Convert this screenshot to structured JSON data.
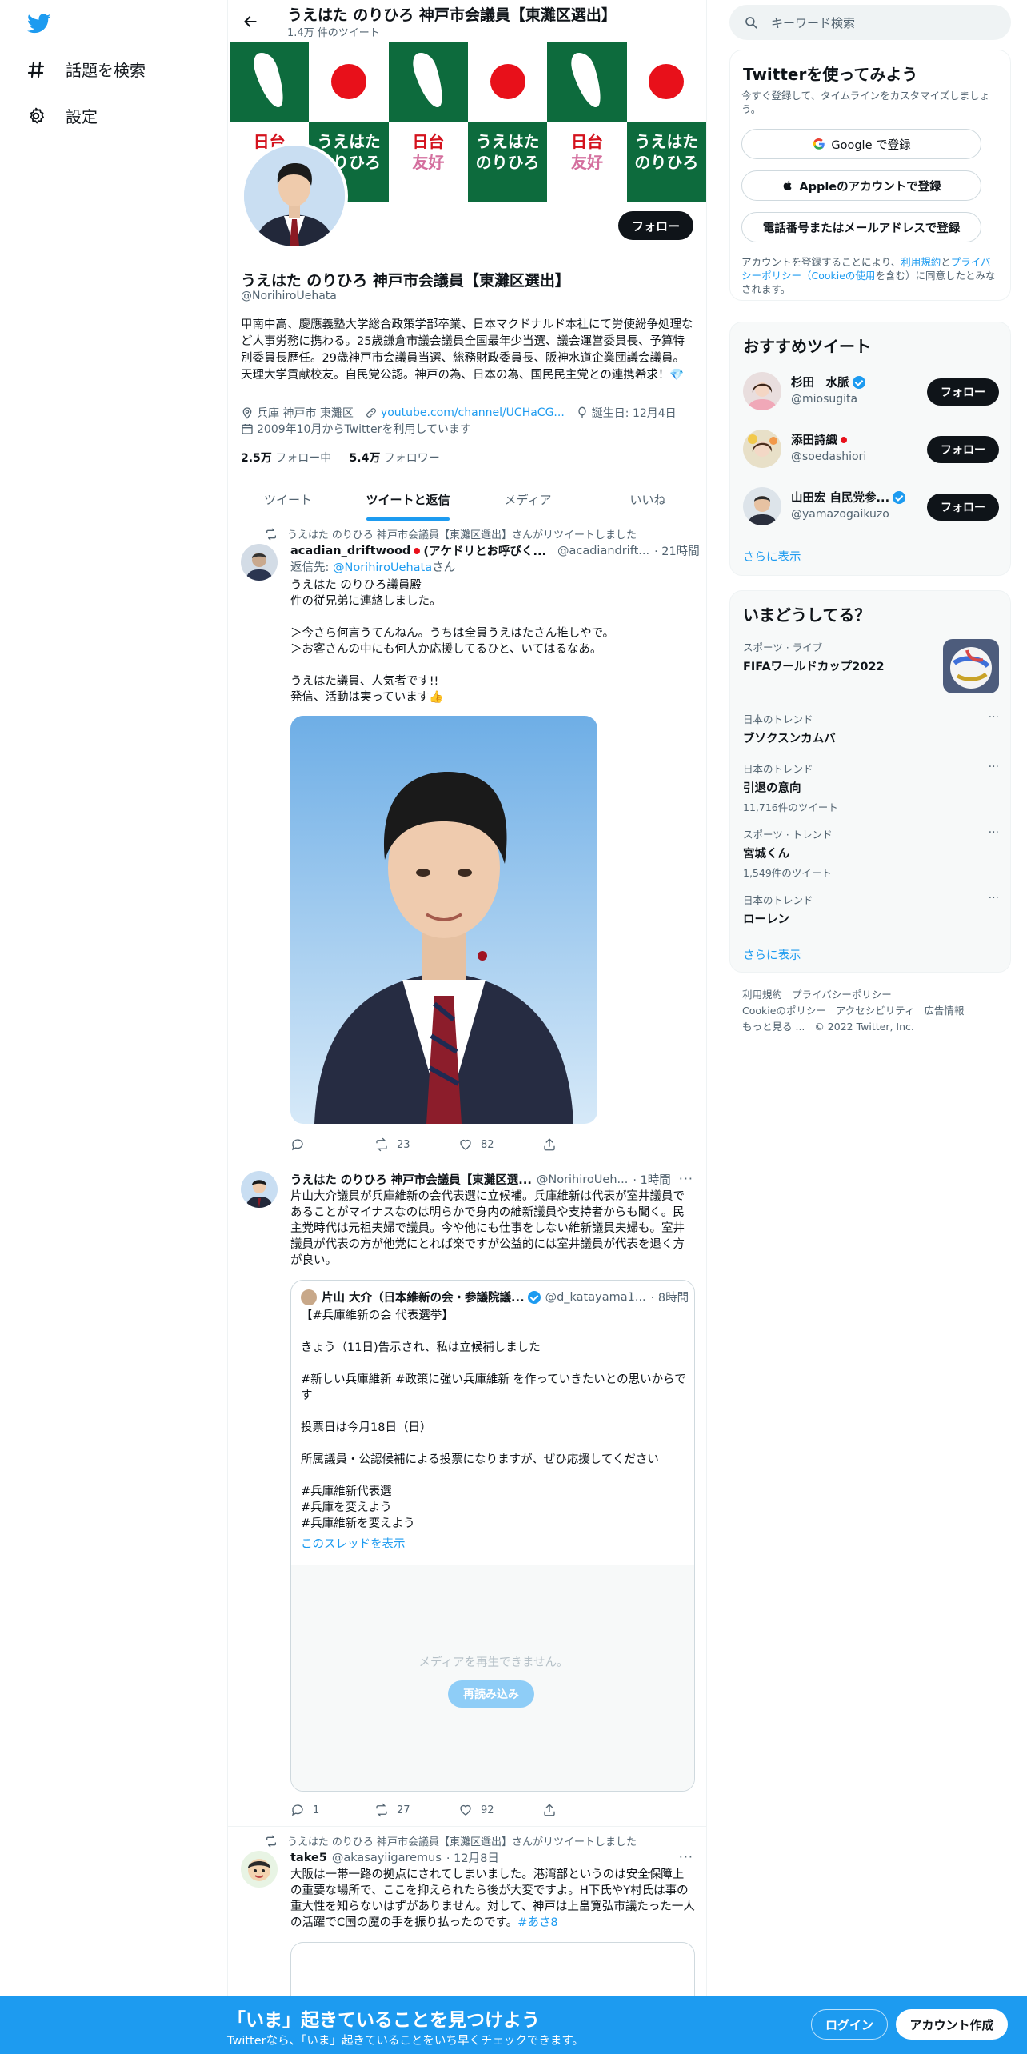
{
  "nav": {
    "explore_label": "話題を検索",
    "settings_label": "設定"
  },
  "profile": {
    "top_name": "うえはた のりひろ 神戸市会議員【東灘区選出】",
    "tweet_count": "1.4万 件のツイート",
    "banner_texts": [
      "日台",
      "うえはた",
      "のりひろ",
      "友好"
    ],
    "follow_label": "フォロー",
    "name": "うえはた のりひろ 神戸市会議員【東灘区選出】",
    "handle": "@NorihiroUehata",
    "bio": "甲南中高、慶應義塾大学総合政策学部卒業、日本マクドナルド本社にて労使紛争処理など人事労務に携わる。25歳鎌倉市議会議員全国最年少当選、議会運営委員長、予算特別委員長歴任。29歳神戸市会議員当選、総務財政委員長、阪神水道企業団議会議員。天理大学貢献校友。自民党公認。神戸の為、日本の為、国民民主党との連携希求！💎",
    "location": "兵庫 神戸市 東灘区",
    "website": "youtube.com/channel/UCHaCG...",
    "birthday": "誕生日: 12月4日",
    "joined": "2009年10月からTwitterを利用しています",
    "following_count": "2.5万",
    "following_label": "フォロー中",
    "followers_count": "5.4万",
    "followers_label": "フォロワー"
  },
  "tabs": [
    "ツイート",
    "ツイートと返信",
    "メディア",
    "いいね"
  ],
  "tweets": [
    {
      "retweet_note": "うえはた のりひろ 神戸市会議員【東灘区選出】さんがリツイートしました",
      "name": "acadian_driftwood",
      "name_suffix": "(アケドリとお呼びく...",
      "handle": "@acadiandrift...",
      "time": "· 21時間",
      "reply_to_label": "返信先: ",
      "reply_to_handle": "@NorihiroUehata",
      "reply_to_suffix": "さん",
      "body": "うえはた のりひろ議員殿\n件の従兄弟に連絡しました。\n\n＞今さら何言うてんねん。うちは全員うえはたさん推しやで。\n＞お客さんの中にも何人か応援してるひと、いてはるなあ。\n\nうえはた議員、人気者です!!\n発信、活動は実っています👍",
      "replies": "",
      "retweets": "23",
      "likes": "82"
    },
    {
      "name": "うえはた のりひろ 神戸市会議員【東灘区選...",
      "handle": "@NorihiroUeh...",
      "time": "· 1時間",
      "body": "片山大介議員が兵庫維新の会代表選に立候補。兵庫維新は代表が室井議員であることがマイナスなのは明らかで身内の維新議員や支持者からも聞く。民主党時代は元祖夫婦で議員。今や他にも仕事をしない維新議員夫婦も。室井議員が代表の方が他党にとれば楽ですが公益的には室井議員が代表を退く方が良い。",
      "quote": {
        "name": "片山 大介（日本維新の会・参議院議...",
        "handle": "@d_katayama1...",
        "time": "· 8時間",
        "body": "【#兵庫維新の会 代表選挙】\n\nきょう（11日)告示され、私は立候補しました\n\n#新しい兵庫維新 #政策に強い兵庫維新 を作っていきたいとの思いからです\n\n投票日は今月18日（日）\n\n所属議員・公認候補による投票になりますが、ぜひ応援してください\n\n#兵庫維新代表選\n#兵庫を変えよう\n#兵庫維新を変えよう",
        "thread_link": "このスレッドを表示",
        "media_error": "メディアを再生できません。",
        "reload_label": "再読み込み"
      },
      "replies": "1",
      "retweets": "27",
      "likes": "92"
    },
    {
      "retweet_note": "うえはた のりひろ 神戸市会議員【東灘区選出】さんがリツイートしました",
      "name": "take5",
      "handle": "@akasayiigaremus",
      "time": "· 12月8日",
      "body": "大阪は一帯一路の拠点にされてしまいました。港湾部というのは安全保障上の重要な場所で、ここを抑えられたら後が大変ですよ。H下氏やY村氏は事の重大性を知らないはずがありません。対して、神戸は上畠寛弘市議たった一人の活躍でC国の魔の手を振り払ったのです。",
      "hashtag": "#あさ8"
    }
  ],
  "right": {
    "search_placeholder": "キーワード検索",
    "signup_title": "Twitterを使ってみよう",
    "signup_sub": "今すぐ登録して、タイムラインをカスタマイズしましょう。",
    "google_btn": "Google で登録",
    "apple_btn": "Appleのアカウントで登録",
    "phone_btn": "電話番号またはメールアドレスで登録",
    "terms_1": "アカウントを登録することにより、",
    "terms_link1": "利用規約",
    "terms_2": "と",
    "terms_link2": "プライバシーポリシー（Cookieの使用",
    "terms_3": "を含む）に同意したとみなされます。",
    "recommend_title": "おすすめツイート",
    "recommend": [
      {
        "name": "杉田　水脈",
        "handle": "@miosugita",
        "verified": true,
        "flag": false
      },
      {
        "name": "添田詩織",
        "handle": "@soedashiori",
        "verified": false,
        "flag": true
      },
      {
        "name": "山田宏 自民党参...",
        "handle": "@yamazogaikuzo",
        "verified": true,
        "flag": false
      }
    ],
    "follow_label": "フォロー",
    "show_more": "さらに表示",
    "trends_title": "いまどうしてる？",
    "trends": [
      {
        "category": "スポーツ · ライブ",
        "name": "FIFAワールドカップ2022",
        "count": ""
      },
      {
        "category": "日本のトレンド",
        "name": "ブソクスンカムバ",
        "count": ""
      },
      {
        "category": "日本のトレンド",
        "name": "引退の意向",
        "count": "11,716件のツイート"
      },
      {
        "category": "スポーツ · トレンド",
        "name": "宮城くん",
        "count": "1,549件のツイート"
      },
      {
        "category": "日本のトレンド",
        "name": "ローレン",
        "count": ""
      }
    ],
    "trends_more": "さらに表示",
    "footer": [
      "利用規約",
      "プライバシーポリシー",
      "Cookieのポリシー",
      "アクセシビリティ",
      "広告情報",
      "もっと見る ...",
      "© 2022 Twitter, Inc."
    ]
  },
  "bottom": {
    "title": "「いま」起きていることを見つけよう",
    "subtitle": "Twitterなら、「いま」起きていることをいち早くチェックできます。",
    "login": "ログイン",
    "signup": "アカウント作成"
  },
  "colors": {
    "accent": "#1d9bf0",
    "banner_green": "#0d6b3d",
    "flag_red": "#e8101a"
  }
}
